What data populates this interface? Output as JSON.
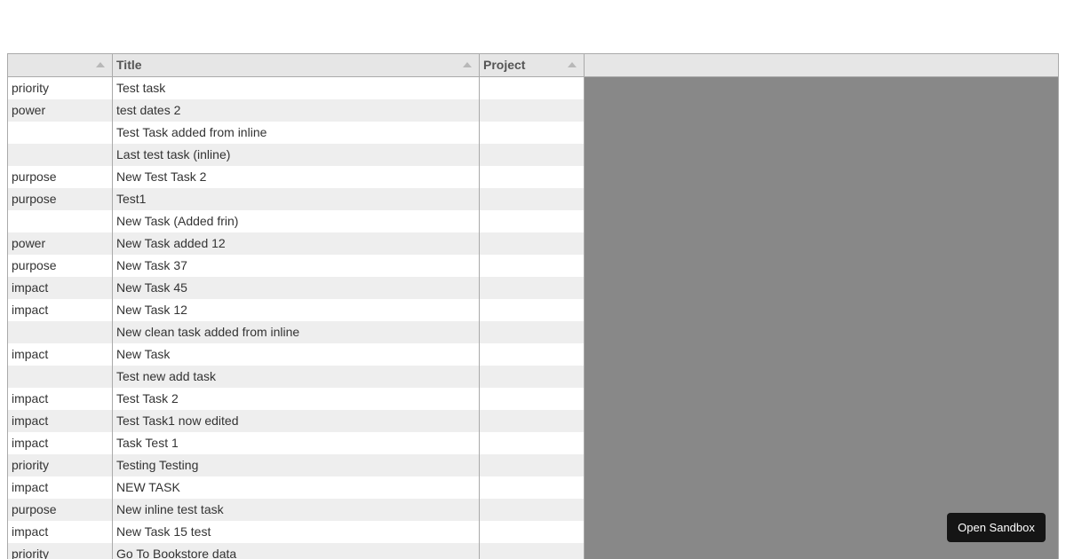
{
  "grid": {
    "columns": [
      {
        "label": ""
      },
      {
        "label": "Title"
      },
      {
        "label": "Project"
      }
    ],
    "rows": [
      {
        "tag": "priority",
        "title": "Test task",
        "project": ""
      },
      {
        "tag": "power",
        "title": "test dates 2",
        "project": ""
      },
      {
        "tag": "",
        "title": "Test Task added from inline",
        "project": ""
      },
      {
        "tag": "",
        "title": "Last test task (inline)",
        "project": ""
      },
      {
        "tag": "purpose",
        "title": "New Test Task 2",
        "project": ""
      },
      {
        "tag": "purpose",
        "title": "Test1",
        "project": ""
      },
      {
        "tag": "",
        "title": "New Task (Added frin)",
        "project": ""
      },
      {
        "tag": "power",
        "title": "New Task added 12",
        "project": ""
      },
      {
        "tag": "purpose",
        "title": "New Task 37",
        "project": ""
      },
      {
        "tag": "impact",
        "title": "New Task 45",
        "project": ""
      },
      {
        "tag": "impact",
        "title": "New Task 12",
        "project": ""
      },
      {
        "tag": "",
        "title": "New clean task added from inline",
        "project": ""
      },
      {
        "tag": "impact",
        "title": "New Task",
        "project": ""
      },
      {
        "tag": "",
        "title": "Test new add task",
        "project": ""
      },
      {
        "tag": "impact",
        "title": "Test Task 2",
        "project": ""
      },
      {
        "tag": "impact",
        "title": "Test Task1 now edited",
        "project": ""
      },
      {
        "tag": "impact",
        "title": "Task Test 1",
        "project": ""
      },
      {
        "tag": "priority",
        "title": "Testing Testing",
        "project": ""
      },
      {
        "tag": "impact",
        "title": "NEW TASK",
        "project": ""
      },
      {
        "tag": "purpose",
        "title": "New inline test task",
        "project": ""
      },
      {
        "tag": "impact",
        "title": "New Task 15 test",
        "project": ""
      },
      {
        "tag": "priority",
        "title": "Go To Bookstore data",
        "project": ""
      }
    ]
  },
  "sandbox_button": {
    "label": "Open Sandbox"
  },
  "icons": {
    "sort": "sort-ascending-icon"
  }
}
